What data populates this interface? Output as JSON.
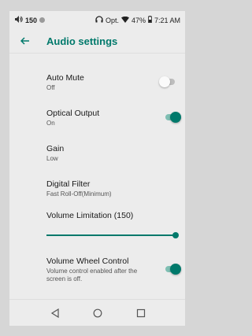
{
  "status_bar": {
    "volume": "150",
    "output_label": "Opt.",
    "battery": "47%",
    "time": "7:21 AM"
  },
  "app_bar": {
    "title": "Audio settings"
  },
  "settings": {
    "auto_mute": {
      "title": "Auto Mute",
      "subtitle": "Off",
      "enabled": false
    },
    "optical_output": {
      "title": "Optical Output",
      "subtitle": "On",
      "enabled": true
    },
    "gain": {
      "title": "Gain",
      "subtitle": "Low"
    },
    "digital_filter": {
      "title": "Digital Filter",
      "subtitle": "Fast Roll-Off(Minimum)"
    },
    "volume_limitation": {
      "title": "Volume Limitation (150)",
      "level": 1.0
    },
    "volume_wheel_control": {
      "title": "Volume Wheel Control",
      "subtitle": "Volume control enabled after the screen is off.",
      "enabled": true
    }
  },
  "colors": {
    "accent": "#00796b",
    "background": "#ececec"
  },
  "icons": [
    "speaker-icon",
    "headphones-icon",
    "wifi-icon",
    "battery-icon",
    "back-arrow-icon",
    "nav-back-icon",
    "nav-home-icon",
    "nav-recents-icon"
  ]
}
